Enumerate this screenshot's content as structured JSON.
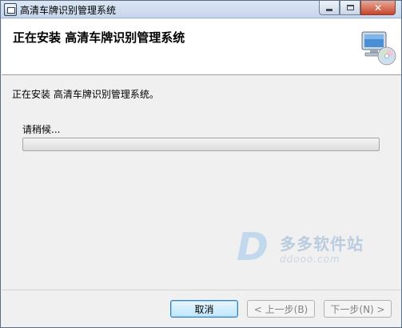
{
  "window": {
    "title": "高清车牌识别管理系统",
    "close_glyph": "✕"
  },
  "header": {
    "title": "正在安装 高清车牌识别管理系统",
    "icon": "computer-cd-icon"
  },
  "content": {
    "status_text": "正在安装 高清车牌识别管理系统。",
    "wait_text": "请稍候...",
    "progress": 0.0
  },
  "watermark": {
    "brand_letter": "D",
    "brand_name": "多多软件站",
    "brand_url": "ddooo.com"
  },
  "buttons": {
    "cancel": "取消",
    "back": "< 上一步(B)",
    "next": "下一步(N) >"
  }
}
